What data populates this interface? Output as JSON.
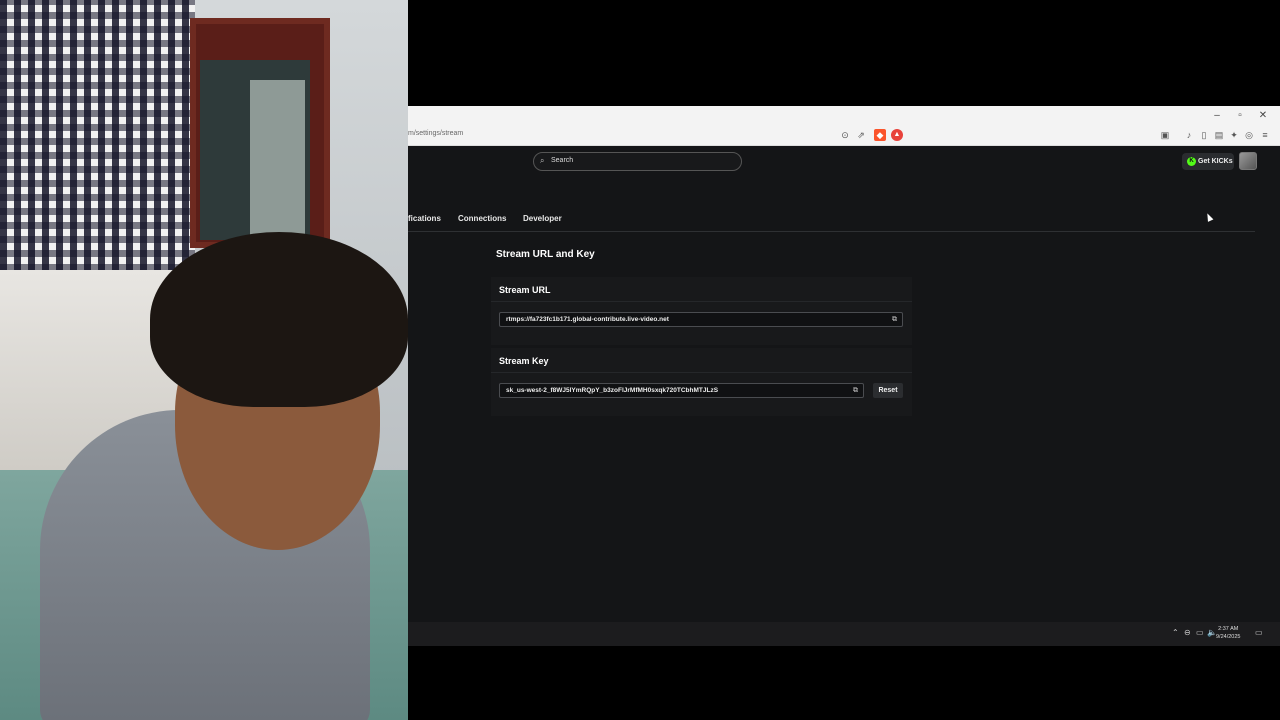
{
  "browser": {
    "url": "m/settings/stream",
    "window_controls": [
      "–",
      "▫",
      "✕"
    ]
  },
  "header": {
    "search_placeholder": "Search",
    "get_kicks_label": "Get KICKs"
  },
  "tabs": [
    {
      "label": "fications"
    },
    {
      "label": "Connections"
    },
    {
      "label": "Developer"
    }
  ],
  "section": {
    "title": "Stream URL and Key"
  },
  "stream_url": {
    "heading": "Stream URL",
    "value": "rtmps://fa723fc1b171.global-contribute.live-video.net"
  },
  "stream_key": {
    "heading": "Stream Key",
    "value": "sk_us-west-2_f8WJ5lYmRQpY_b3zoFlJrMfMH0sxqk720TCbhMTJLzS",
    "reset_label": "Reset"
  },
  "taskbar": {
    "time": "2:37 AM",
    "date": "9/24/2025"
  },
  "colors": {
    "page_bg": "#141517",
    "card_bg": "#18191b",
    "kick_green": "#53fc18"
  }
}
